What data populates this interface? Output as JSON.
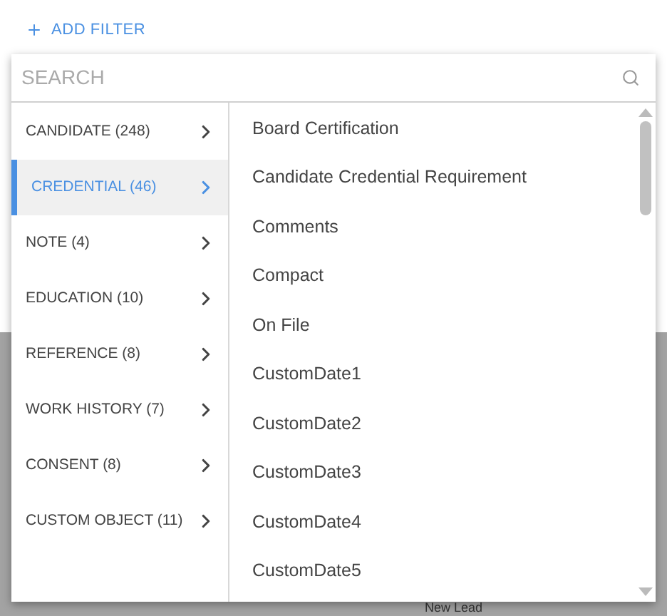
{
  "add_filter": {
    "label": "ADD FILTER"
  },
  "search": {
    "placeholder": "SEARCH"
  },
  "categories": [
    {
      "label": "CANDIDATE (248)",
      "selected": false
    },
    {
      "label": "CREDENTIAL (46)",
      "selected": true
    },
    {
      "label": "NOTE (4)",
      "selected": false
    },
    {
      "label": "EDUCATION (10)",
      "selected": false
    },
    {
      "label": "REFERENCE (8)",
      "selected": false
    },
    {
      "label": "WORK HISTORY (7)",
      "selected": false
    },
    {
      "label": "CONSENT (8)",
      "selected": false
    },
    {
      "label": "CUSTOM OBJECT (11)",
      "selected": false
    }
  ],
  "fields": [
    "Board Certification",
    "Candidate Credential Requirement",
    "Comments",
    "Compact",
    "On File",
    "CustomDate1",
    "CustomDate2",
    "CustomDate3",
    "CustomDate4",
    "CustomDate5"
  ],
  "background": {
    "status": "New Lead"
  }
}
